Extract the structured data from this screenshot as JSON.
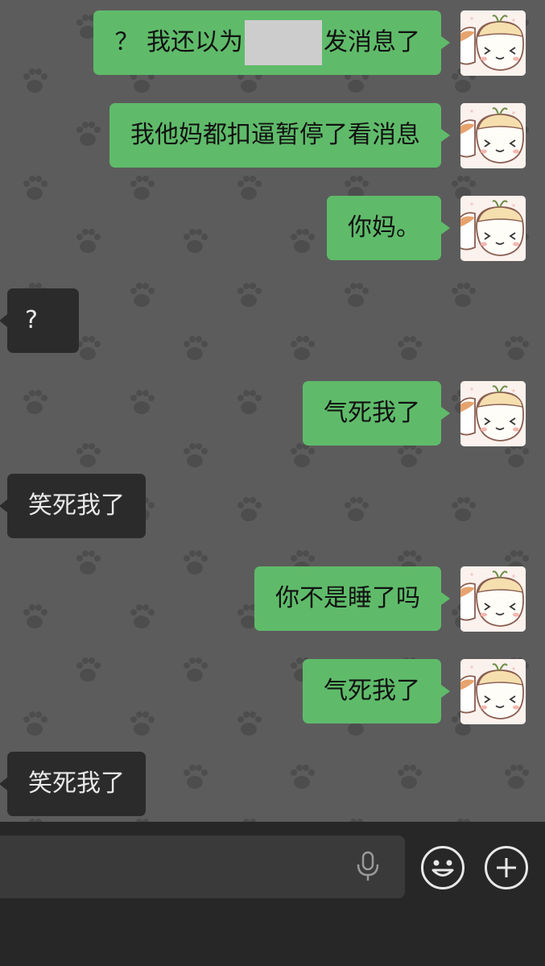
{
  "messages": [
    {
      "side": "right",
      "before": "？ 我还以为",
      "after": "发消息了",
      "redacted": true
    },
    {
      "side": "right",
      "text": "我他妈都扣逼暂停了看消息"
    },
    {
      "side": "right",
      "text": "你妈。"
    },
    {
      "side": "left",
      "text": "?"
    },
    {
      "side": "right",
      "text": "气死我了"
    },
    {
      "side": "left",
      "text": "笑死我了"
    },
    {
      "side": "right",
      "text": "你不是睡了吗"
    },
    {
      "side": "right",
      "text": "气死我了"
    },
    {
      "side": "left",
      "text": "笑死我了"
    }
  ],
  "input": {
    "value": "",
    "icons": [
      "mic-icon",
      "emoji-icon",
      "plus-icon"
    ]
  },
  "colors": {
    "chat_background": "#5c5c5c",
    "outgoing_bubble": "#5fbb6a",
    "incoming_bubble": "#2b2b2b",
    "input_bar": "#272727"
  }
}
